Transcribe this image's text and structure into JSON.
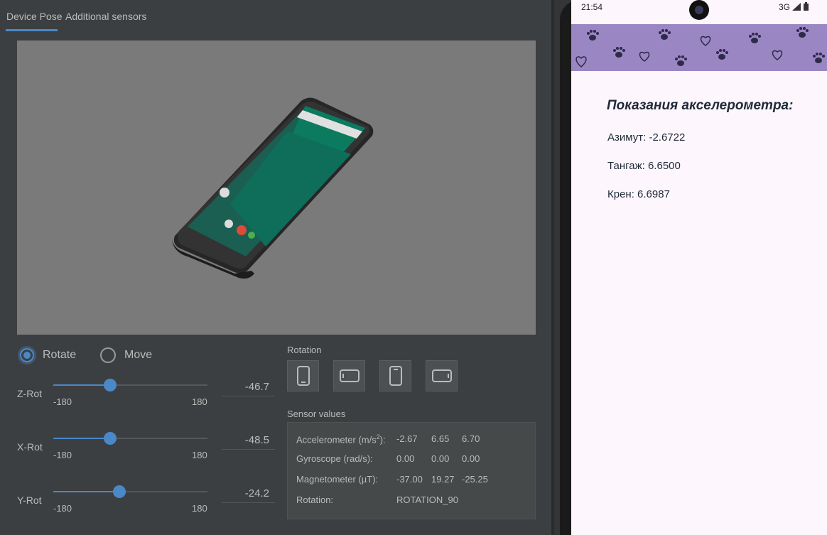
{
  "tabs": [
    {
      "label": "Device Pose"
    },
    {
      "label": "Additional sensors"
    }
  ],
  "mode": {
    "rotate_label": "Rotate",
    "move_label": "Move",
    "selected": "Rotate"
  },
  "sliders": [
    {
      "label": "Z-Rot",
      "min": "-180",
      "max": "180",
      "value": "-46.7",
      "fraction": 0.37
    },
    {
      "label": "X-Rot",
      "min": "-180",
      "max": "180",
      "value": "-48.5",
      "fraction": 0.37
    },
    {
      "label": "Y-Rot",
      "min": "-180",
      "max": "180",
      "value": "-24.2",
      "fraction": 0.43
    }
  ],
  "rotation": {
    "title": "Rotation",
    "buttons": [
      "portrait-icon",
      "landscape-icon",
      "reverse-portrait-icon",
      "reverse-landscape-icon"
    ]
  },
  "sensors": {
    "title": "Sensor values",
    "accelerometer": {
      "label": "Accelerometer (m/s",
      "sup": "2",
      "label_end": "):",
      "v1": "-2.67",
      "v2": "6.65",
      "v3": "6.70"
    },
    "gyroscope": {
      "label": "Gyroscope (rad/s):",
      "v1": "0.00",
      "v2": "0.00",
      "v3": "0.00"
    },
    "magnetometer": {
      "label": "Magnetometer (µT):",
      "v1": "-37.00",
      "v2": "19.27",
      "v3": "-25.25"
    },
    "rotation": {
      "label": "Rotation:",
      "value": "ROTATION_90"
    }
  },
  "phone": {
    "time": "21:54",
    "network": "3G",
    "title": "Показания акселерометра:",
    "azimuth": "Азимут: -2.6722",
    "pitch": "Тангаж: 6.6500",
    "roll": "Крен: 6.6987"
  },
  "colors": {
    "accent": "#4a88c7",
    "panel": "#3c3f41",
    "banner": "#9b86c4"
  }
}
